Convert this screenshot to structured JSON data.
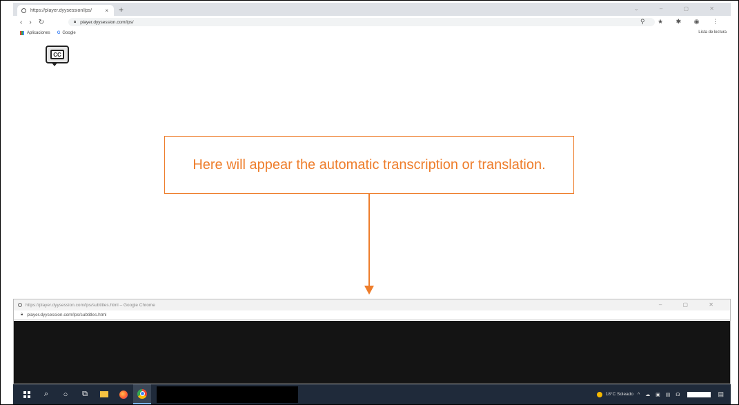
{
  "browser": {
    "tab_title": "https://player.dyysession/lps/",
    "tab_close": "×",
    "new_tab": "+",
    "window_controls": "⌄ – ▢ ✕",
    "nav_back": "‹",
    "nav_forward": "›",
    "nav_reload": "↻",
    "url": "player.dyysession.com/lps/",
    "toolbar_right": "⚲ ★ ✱ ◉ ⋮",
    "bookmarks": {
      "apps": "Aplicaciones",
      "google": "Google",
      "reading_list": "Lista de lectura"
    }
  },
  "page": {
    "cc_button": "CC"
  },
  "callout": {
    "text": "Here will appear the automatic transcription or translation."
  },
  "popup": {
    "title": "https://player.dyysession.com/lps/subtitles.html – Google Chrome",
    "controls": "– ▢ ✕",
    "url": "player.dyysession.com/lps/subtitles.html"
  },
  "taskbar": {
    "weather": "18°C Soleado",
    "tray_icons": "^ ☁ ▣ ▤ ☊",
    "notifications": "▤"
  },
  "colors": {
    "accent": "#ee7d2b",
    "taskbar": "#1f2a3a",
    "popup_body": "#141414"
  }
}
